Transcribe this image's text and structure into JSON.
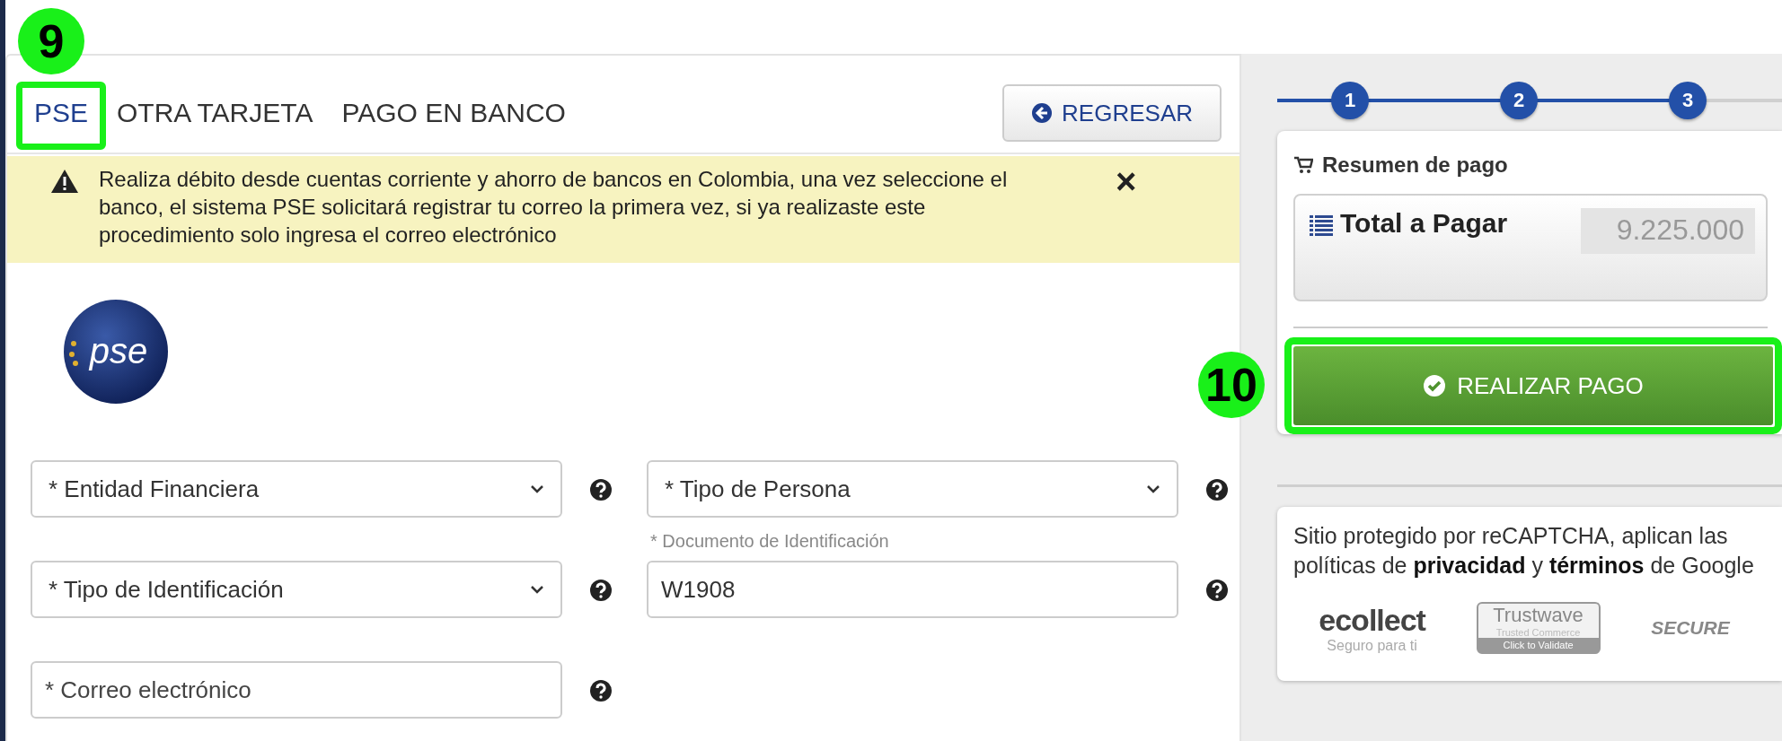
{
  "tabs": [
    {
      "label": "PSE",
      "selected": true,
      "marker": "9"
    },
    {
      "label": "OTRA TARJETA",
      "selected": false
    },
    {
      "label": "PAGO EN BANCO",
      "selected": false
    }
  ],
  "back_button": {
    "label": "REGRESAR"
  },
  "alert": {
    "text": "Realiza débito desde cuentas corriente y ahorro de bancos en Colombia, una vez seleccione el banco, el sistema PSE solicitará registrar tu correo la primera vez, si ya realizaste este procedimiento solo ingresa el correo electrónico",
    "close": "×"
  },
  "logo": {
    "text": "pse"
  },
  "form": [
    {
      "kind": "select",
      "value": "* Entidad Financiera"
    },
    {
      "kind": "select",
      "value": "* Tipo de Persona"
    },
    {
      "kind": "select",
      "value": "* Tipo de Identificación"
    },
    {
      "kind": "input",
      "label": "* Documento de Identificación",
      "value": "W1908"
    },
    {
      "kind": "input",
      "placeholder": "* Correo electrónico"
    }
  ],
  "stepper": {
    "level": 0.78,
    "steps": [
      "1",
      "2",
      "3"
    ]
  },
  "summary": {
    "title": "Resumen de pago",
    "total_label": "Total a Pagar",
    "total_value": "9.225.000"
  },
  "pay_button": {
    "label": "REALIZAR PAGO",
    "marker": "10"
  },
  "recaptcha": {
    "text": "Sitio protegido por reCAPTCHA, aplican las políticas de **privacidad** y **términos** de Google"
  },
  "seals": [
    {
      "kind": "ecollect",
      "title": "ecollect",
      "subtitle": "Seguro para ti"
    },
    {
      "kind": "trustwave",
      "title": "Trustwave",
      "subtitle": "Trusted Commerce",
      "action": "Click to Validate"
    },
    {
      "kind": "secure",
      "title": "SECURE"
    }
  ]
}
